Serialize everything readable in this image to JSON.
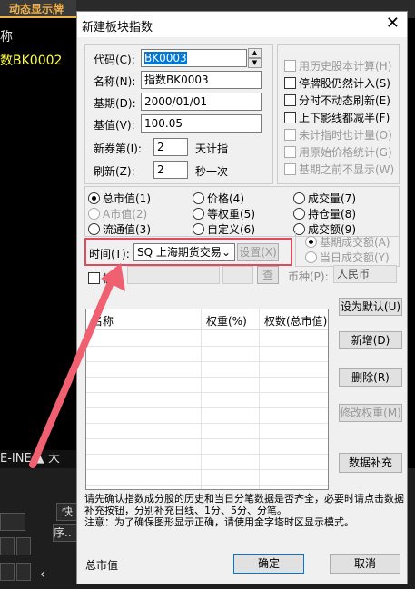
{
  "background": {
    "tab_label": "动态显示牌",
    "line1": "称",
    "line2": "数BK0002",
    "bottom_bar": "E-INE  ▲  大",
    "btn_kuai": "快",
    "btn_xu": "序.."
  },
  "dialog": {
    "title": "新建板块指数",
    "close_label": "✕",
    "fields": {
      "code_label": "代码(C):",
      "code_value": "BK0003",
      "name_label": "名称(N):",
      "name_value": "指数BK0003",
      "base_date_label": "基期(D):",
      "base_date_value": "2000/01/01",
      "base_value_label": "基值(V):",
      "base_value_value": "100.05",
      "new_stock_label": "新券第(I):",
      "new_stock_value": "2",
      "new_stock_unit": "天计指",
      "refresh_label": "刷新(Z):",
      "refresh_value": "2",
      "refresh_unit": "秒一次"
    },
    "options": [
      {
        "label": "用历史股本计算(H)",
        "checked": false,
        "disabled": true
      },
      {
        "label": "停牌股仍然计入(S)",
        "checked": false,
        "disabled": false
      },
      {
        "label": "分时不动态刷新(E)",
        "checked": false,
        "disabled": false
      },
      {
        "label": "上下影线都减半(F)",
        "checked": false,
        "disabled": false
      },
      {
        "label": "未计指时也计量(O)",
        "checked": false,
        "disabled": true
      },
      {
        "label": "用原始价格统计(G)",
        "checked": false,
        "disabled": true
      },
      {
        "label": "基期之前不显示(W)",
        "checked": false,
        "disabled": true
      }
    ],
    "weights": {
      "col1": [
        {
          "label": "总市值(1)",
          "on": true,
          "disabled": false
        },
        {
          "label": "A市值(2)",
          "on": false,
          "disabled": true
        },
        {
          "label": "流通值(3)",
          "on": false,
          "disabled": false
        }
      ],
      "col2": [
        {
          "label": "价格(4)",
          "on": false,
          "disabled": false
        },
        {
          "label": "等权重(5)",
          "on": false,
          "disabled": false
        },
        {
          "label": "自定义(6)",
          "on": false,
          "disabled": false
        }
      ],
      "col3": [
        {
          "label": "成交量(7)",
          "on": false,
          "disabled": false
        },
        {
          "label": "持仓量(8)",
          "on": false,
          "disabled": false
        },
        {
          "label": "成交额(9)",
          "on": false,
          "disabled": false
        },
        {
          "label": "基期成交额(A)",
          "on": true,
          "disabled": true
        },
        {
          "label": "当日成交额(Y)",
          "on": false,
          "disabled": true
        }
      ]
    },
    "time_label": "时间(T):",
    "time_value": "SQ 上海期货交易",
    "settings_button": "设置(X)",
    "board_label": "板",
    "query_button": "查",
    "currency_label": "币种(P):",
    "currency_value": "人民币",
    "table": {
      "col_name": "名称",
      "col_weight": "权重(%)",
      "col_weight2": "权数(总市值)"
    },
    "side_buttons": {
      "set_default": "设为默认(U)",
      "add": "新增(D)",
      "delete": "删除(R)",
      "edit_weight": "修改权重(M)",
      "data_fill": "数据补充"
    },
    "note": "请先确认指数成分股的历史和当日分笔数据是否齐全，必要时请点击数据补充按钮，分别补充日线、1分、5分、分笔。\n注意：为了确保图形显示正确，请使用金字塔时区显示模式。",
    "footer_label": "总市值",
    "ok_button": "确定",
    "cancel_button": "取消"
  },
  "colors": {
    "highlight_box": "#e04a5a",
    "arrow": "#f06070"
  }
}
